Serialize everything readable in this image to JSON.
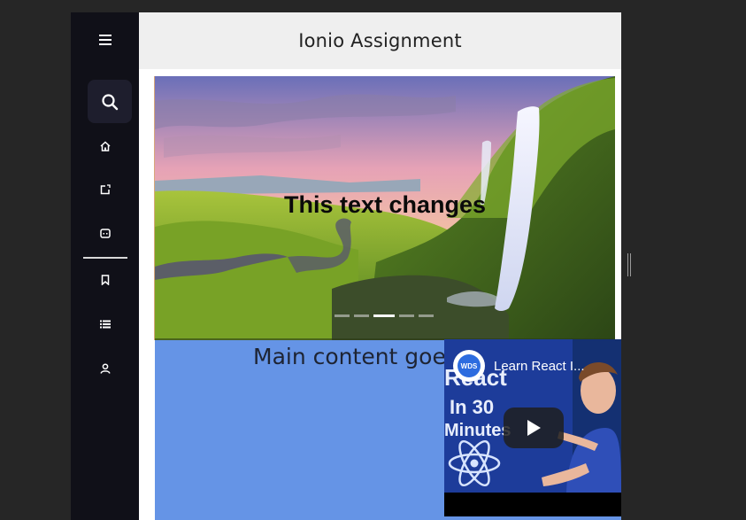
{
  "app": {
    "title": "Ionio Assignment"
  },
  "sidebar": {
    "items": [
      {
        "icon": "menu-icon"
      },
      {
        "icon": "search-icon",
        "active": true
      },
      {
        "icon": "home-icon"
      },
      {
        "icon": "edit-icon"
      },
      {
        "icon": "chat-icon"
      },
      {
        "icon": "bookmark-icon"
      },
      {
        "icon": "list-icon"
      },
      {
        "icon": "user-icon"
      }
    ]
  },
  "carousel": {
    "text": "This text changes",
    "slide_count": 5,
    "active_slide": 3
  },
  "main": {
    "text": "Main content goes"
  },
  "video": {
    "title": "Learn React I...",
    "channel_badge": "WDS",
    "thumbnail_lines": [
      "React",
      "In 30",
      "Minutes"
    ]
  },
  "colors": {
    "sidebar_bg": "#101018",
    "header_bg": "#efefef",
    "content_bg": "#6594e6",
    "page_bg": "#262626"
  }
}
